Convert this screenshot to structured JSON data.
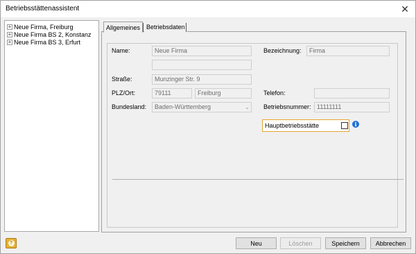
{
  "window": {
    "title": "Betriebsstättenassistent",
    "close_glyph": "✕"
  },
  "tree": {
    "items": [
      {
        "label": "Neue Firma, Freiburg",
        "expander": "+"
      },
      {
        "label": "Neue Firma BS 2, Konstanz",
        "expander": "+"
      },
      {
        "label": "Neue Firma BS 3, Erfurt",
        "expander": "+"
      }
    ]
  },
  "tabs": [
    {
      "label": "Allgemeines",
      "active": true
    },
    {
      "label": "Betriebsdaten",
      "active": false
    }
  ],
  "form": {
    "name_label": "Name:",
    "name_value": "Neue Firma",
    "name2_value": "",
    "street_label": "Straße:",
    "street_value": "Munzinger Str. 9",
    "plz_label": "PLZ/Ort:",
    "plz_value": "79111",
    "city_value": "Freiburg",
    "state_label": "Bundesland:",
    "state_value": "Baden-Württemberg",
    "designation_label": "Bezeichnung:",
    "designation_value": "Firma",
    "phone_label": "Telefon:",
    "phone_value": "",
    "company_number_label": "Betriebsnummer:",
    "company_number_value": "11111111",
    "headquarters_label": "Hauptbetriebsstätte",
    "headquarters_checked": false,
    "info_glyph": "i"
  },
  "footer": {
    "help_glyph": "?",
    "new_label": "Neu",
    "delete_label": "Löschen",
    "save_label": "Speichern",
    "cancel_label": "Abbrechen"
  },
  "colors": {
    "focus_border": "#e6a530",
    "info_icon": "#1f6fd6",
    "help_button": "#e6b13a"
  }
}
